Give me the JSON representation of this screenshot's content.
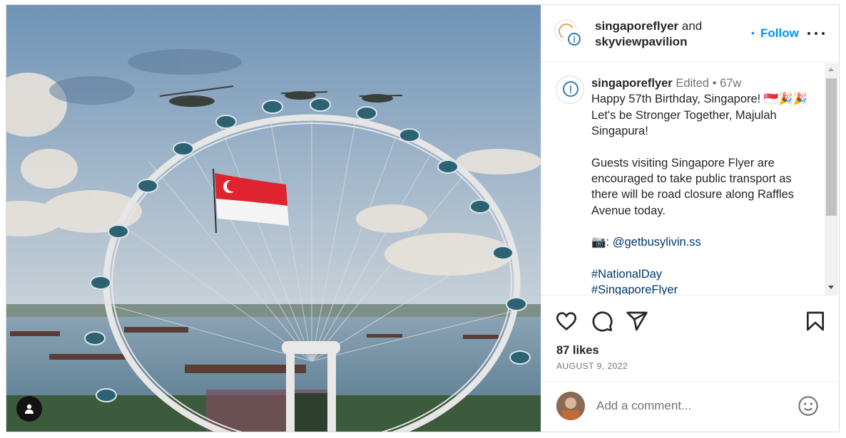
{
  "post": {
    "image_alt": "Singapore Flyer with helicopters and the Singapore flag"
  },
  "header": {
    "author": "singaporeflyer",
    "and": "and",
    "collaborator": "skyviewpavilion",
    "dot": "•",
    "follow_label": "Follow",
    "more_icon": "more-horizontal-icon"
  },
  "caption": {
    "username": "singaporeflyer",
    "edited": "Edited",
    "dot": "•",
    "age": "67w",
    "line1": "Happy 57th Birthday, Singapore! 🇸🇬🎉🎉Let's be Stronger Together, Majulah Singapura!",
    "line2": "Guests visiting Singapore Flyer are encouraged to take public transport as there will be road closure along Raffles Avenue today.",
    "camera": "📷",
    "credit_sep": ": ",
    "credit": "@getbusylivin.ss",
    "tag1": "#NationalDay",
    "tag2": "#SingaporeFlyer"
  },
  "actions": {
    "like_icon": "heart-icon",
    "comment_icon": "comment-icon",
    "share_icon": "send-icon",
    "save_icon": "bookmark-icon"
  },
  "stats": {
    "likes": "87 likes",
    "date": "AUGUST 9, 2022"
  },
  "add_comment": {
    "placeholder": "Add a comment...",
    "emoji_icon": "emoji-icon"
  },
  "colors": {
    "accent": "#0095f6",
    "link": "#00376b",
    "muted": "#737373",
    "flag_red": "#e0242f"
  }
}
